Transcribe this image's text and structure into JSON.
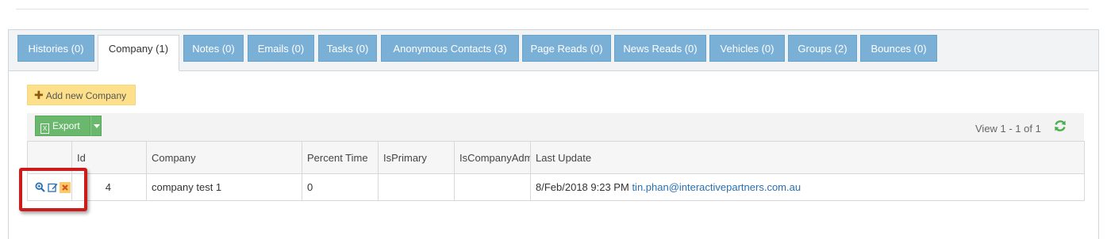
{
  "tabs": [
    {
      "label": "Histories (0)"
    },
    {
      "label": "Company (1)",
      "active": true
    },
    {
      "label": "Notes (0)"
    },
    {
      "label": "Emails (0)"
    },
    {
      "label": "Tasks (0)"
    },
    {
      "label": "Anonymous Contacts (3)"
    },
    {
      "label": "Page Reads (0)"
    },
    {
      "label": "News Reads (0)"
    },
    {
      "label": "Vehicles (0)"
    },
    {
      "label": "Groups (2)"
    },
    {
      "label": "Bounces (0)"
    }
  ],
  "add_button": {
    "icon": "plus-icon",
    "label": "Add new Company"
  },
  "export_button": {
    "icon": "excel-icon",
    "label": "Export"
  },
  "pager": {
    "text": "View 1 - 1 of 1"
  },
  "table": {
    "headers": [
      "",
      "Id",
      "Company",
      "Percent Time",
      "IsPrimary",
      "IsCompanyAdmin",
      "Last Update"
    ],
    "rows": [
      {
        "id": "4",
        "company": "company test 1",
        "percent_time": "0",
        "is_primary": "",
        "is_company_admin": "",
        "last_update": "8/Feb/2018 9:23 PM",
        "updated_by": "tin.phan@interactivepartners.com.au"
      }
    ]
  },
  "colors": {
    "tab": "#7bb0d6",
    "add": "#fde089",
    "export": "#6ab86d",
    "highlight": "#cc1b1b",
    "link": "#2a6fb0"
  }
}
